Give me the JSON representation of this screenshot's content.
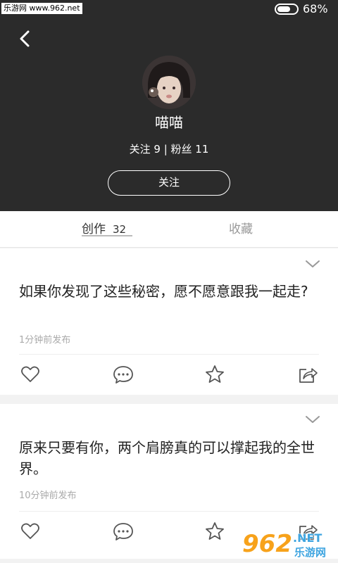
{
  "status_bar": {
    "watermark": "乐游网 www.962.net",
    "battery_level": 0.68,
    "battery_text": "68%"
  },
  "profile": {
    "name": "喵喵",
    "stats": "关注 9 | 粉丝 11",
    "follow_label": "关注"
  },
  "tabs": [
    {
      "label": "创作",
      "count": "32",
      "active": true
    },
    {
      "label": "收藏",
      "active": false
    }
  ],
  "posts": [
    {
      "text": "如果你发现了这些秘密，愿不愿意跟我一起走?",
      "time": "1分钟前发布"
    },
    {
      "text": "原来只要有你，两个肩膀真的可以撑起我的全世界。",
      "time": "10分钟前发布"
    }
  ],
  "watermark_logo": {
    "num": "962",
    "suffix": ".NET",
    "name": "乐游网"
  },
  "colors": {
    "header_bg": "#2b2b2b",
    "text": "#222222",
    "muted": "#aaaaaa",
    "icon": "#555555"
  }
}
